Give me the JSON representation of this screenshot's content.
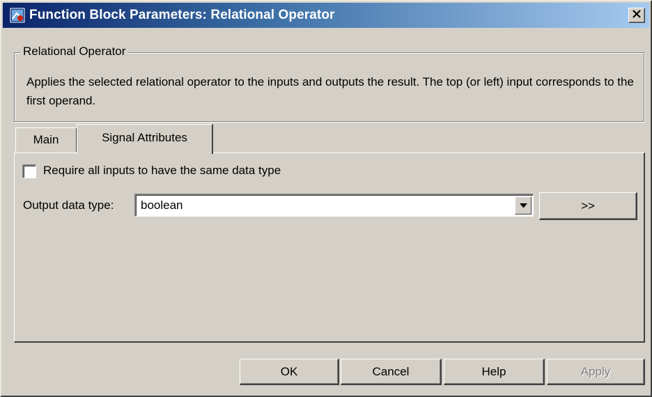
{
  "window": {
    "title": "Function Block Parameters: Relational Operator",
    "close_glyph": "✕"
  },
  "group": {
    "legend": "Relational Operator",
    "description": "Applies the selected relational operator to the inputs and outputs the result. The top (or left) input corresponds to the first operand."
  },
  "tabs": [
    {
      "label": "Main",
      "active": false
    },
    {
      "label": "Signal Attributes",
      "active": true
    }
  ],
  "signal": {
    "require_same_type_label": "Require all inputs to have the same data type",
    "require_same_type_checked": false,
    "output_type_label": "Output data type:",
    "output_type_value": "boolean",
    "expand_label": ">>"
  },
  "buttons": {
    "ok": "OK",
    "cancel": "Cancel",
    "help": "Help",
    "apply": "Apply"
  },
  "icons": {
    "app": "simulink-block-icon",
    "close": "close-icon",
    "dropdown": "chevron-down-icon"
  },
  "colors": {
    "title_start": "#0a246a",
    "title_end": "#a6caf0",
    "face": "#d4d0c8"
  }
}
